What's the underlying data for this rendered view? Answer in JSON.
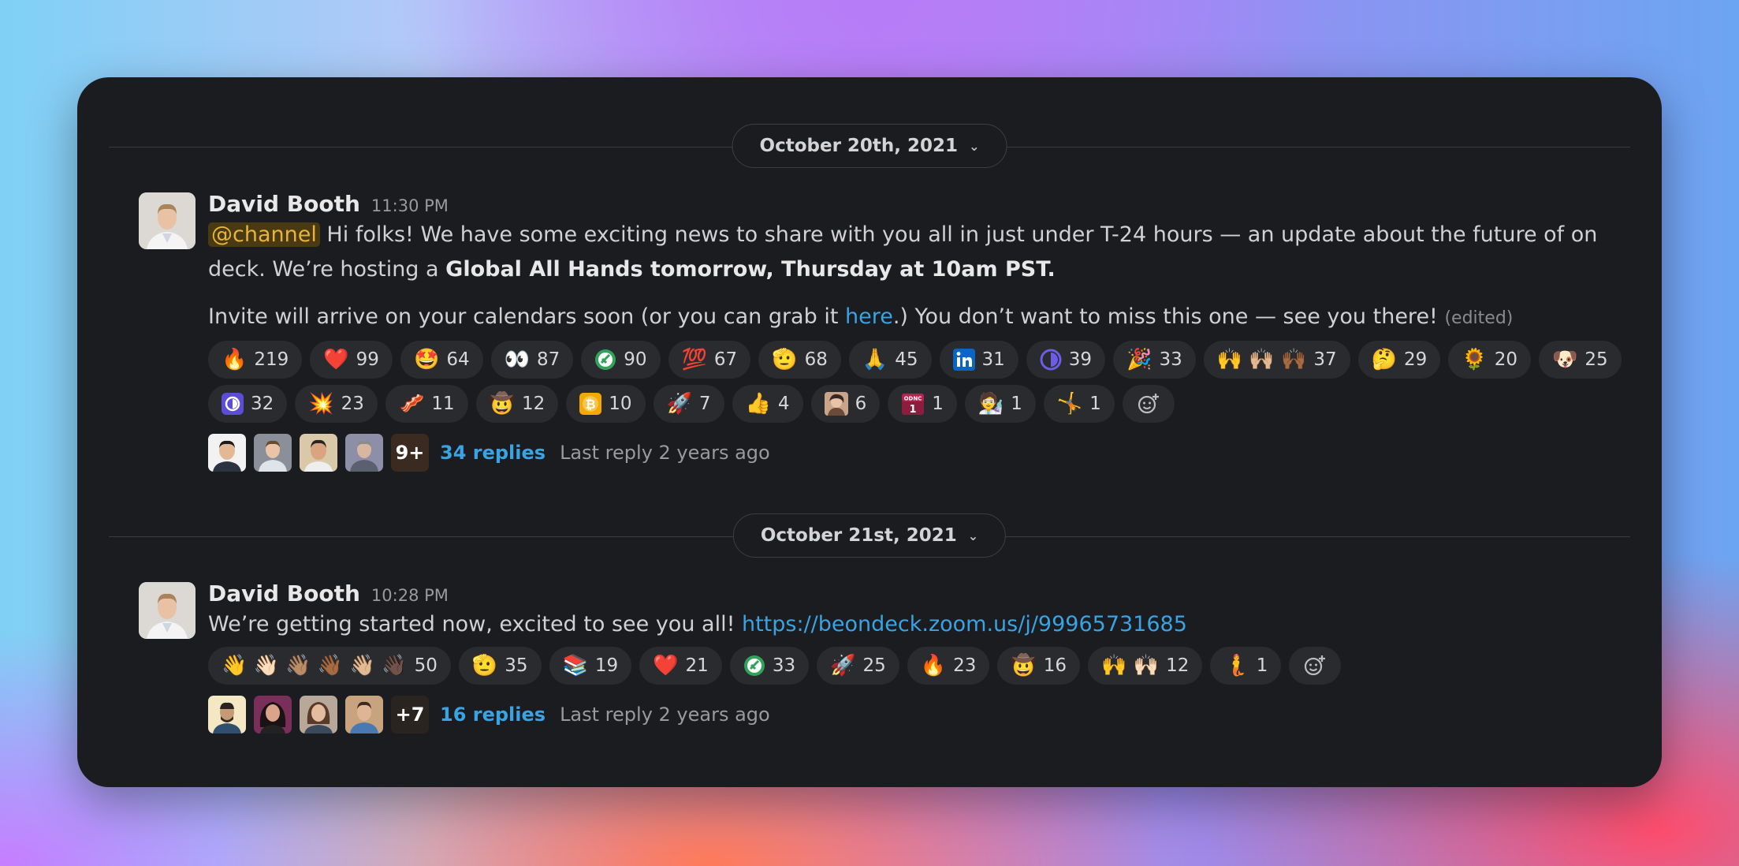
{
  "messages": [
    {
      "date": "October 20th, 2021",
      "author": "David Booth",
      "time": "11:30 PM",
      "p1": {
        "mention": "@channel",
        "text1": " Hi folks! We have some exciting news to share with you all in just under T-24 hours — an update about the future of on deck. We’re hosting a ",
        "bold": "Global All Hands tomorrow, Thursday at 10am PST."
      },
      "p2": {
        "text1": "Invite will arrive on your calendars soon (or you can grab it ",
        "link": "here",
        "text2": ".) You don’t want to miss this one — see you there! ",
        "edited": "(edited)"
      },
      "reactions": [
        {
          "emoji": "🔥",
          "count": "219"
        },
        {
          "emoji": "❤️",
          "count": "99"
        },
        {
          "emoji": "🤩",
          "count": "64"
        },
        {
          "emoji": "👀",
          "count": "87"
        },
        {
          "emoji": "custom-green-logo",
          "count": "90"
        },
        {
          "emoji": "💯",
          "count": "67"
        },
        {
          "emoji": "🫡",
          "count": "68"
        },
        {
          "emoji": "🙏",
          "count": "45"
        },
        {
          "emoji": "custom-linkedin-logo",
          "count": "31"
        },
        {
          "emoji": "custom-purple-circle-logo",
          "count": "39"
        },
        {
          "emoji": "🎉",
          "count": "33"
        },
        {
          "emoji": "🙌 🙌🏼 🙌🏾",
          "count": "37"
        },
        {
          "emoji": "🤔",
          "count": "29"
        },
        {
          "emoji": "🌻",
          "count": "20"
        },
        {
          "emoji": "🐶",
          "count": "25"
        },
        {
          "emoji": "custom-purple-square-logo",
          "count": "32"
        },
        {
          "emoji": "💥",
          "count": "23"
        },
        {
          "emoji": "🥓",
          "count": "11"
        },
        {
          "emoji": "🤠",
          "count": "12"
        },
        {
          "emoji": "custom-bitcoin-logo",
          "count": "10"
        },
        {
          "emoji": "🚀",
          "count": "7"
        },
        {
          "emoji": "👍",
          "count": "4"
        },
        {
          "emoji": "custom-face-photo",
          "count": "6"
        },
        {
          "emoji": "custom-odnc-calendar",
          "count": "1"
        },
        {
          "emoji": "🧑‍🔬",
          "count": "1"
        },
        {
          "emoji": "🤸",
          "count": "1"
        }
      ],
      "thread": {
        "more_label": "9+",
        "replies": "34 replies",
        "last_reply": "Last reply 2 years ago"
      }
    },
    {
      "date": "October 21st, 2021",
      "author": "David Booth",
      "time": "10:28 PM",
      "p1": {
        "text1": "We’re getting started now, excited to see you all! ",
        "link": "https://beondeck.zoom.us/j/99965731685"
      },
      "reactions": [
        {
          "emoji": "👋 👋🏻 👋🏽 👋🏾 👋🏼 👋🏿",
          "count": "50"
        },
        {
          "emoji": "🫡",
          "count": "35"
        },
        {
          "emoji": "📚",
          "count": "19"
        },
        {
          "emoji": "❤️",
          "count": "21"
        },
        {
          "emoji": "custom-green-logo",
          "count": "33"
        },
        {
          "emoji": "🚀",
          "count": "25"
        },
        {
          "emoji": "🔥",
          "count": "23"
        },
        {
          "emoji": "🤠",
          "count": "16"
        },
        {
          "emoji": "🙌 🙌🏻",
          "count": "12"
        },
        {
          "emoji": "🧜",
          "count": "1"
        }
      ],
      "thread": {
        "more_label": "+7",
        "replies": "16 replies",
        "last_reply": "Last reply 2 years ago"
      }
    }
  ],
  "colors": {
    "card_bg": "#1b1c1f",
    "reaction_bg": "#2a2b2f",
    "link": "#3aa3e3",
    "mention": "#e6b43e"
  }
}
